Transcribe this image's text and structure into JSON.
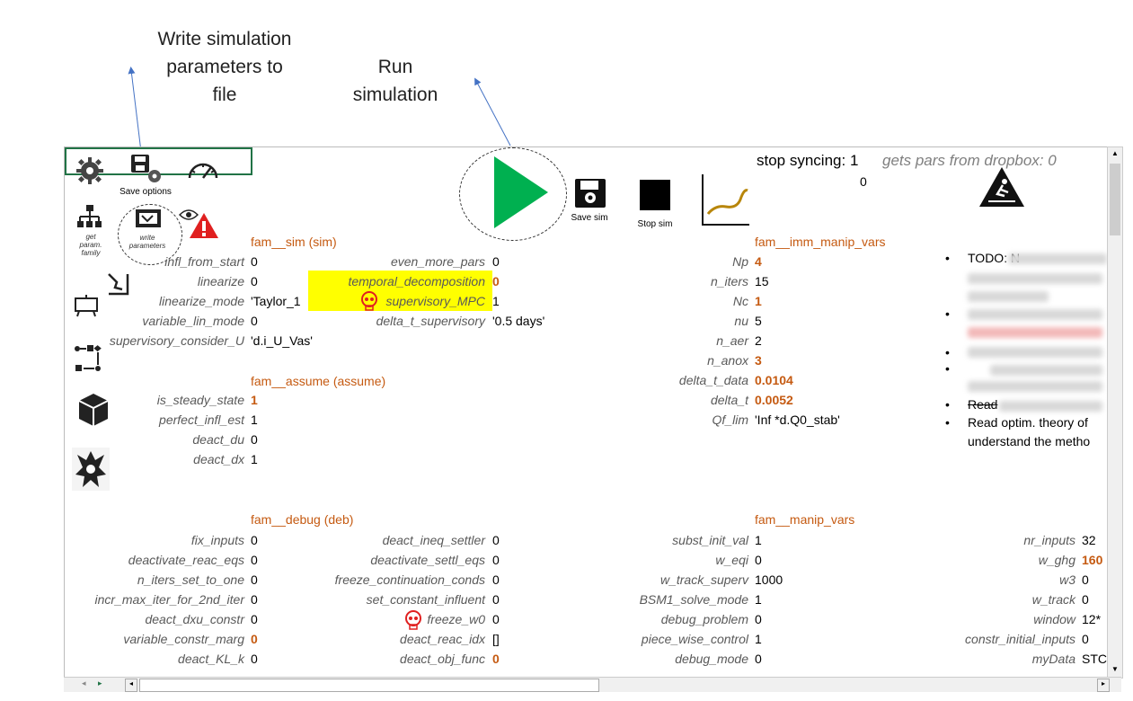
{
  "callouts": {
    "write_params": [
      "Write simulation",
      "parameters to",
      "file"
    ],
    "run_sim": [
      "Run",
      "simulation"
    ]
  },
  "toolbar": {
    "save_options": "Save options",
    "get_param_family": [
      "get",
      "param.",
      "family"
    ],
    "write_parameters": [
      "write",
      "parameters"
    ],
    "save_sim": "Save sim",
    "stop_sim": "Stop sim"
  },
  "header": {
    "stop_syncing_label": "stop syncing: 1",
    "stop_syncing_value": "0",
    "gets_pars": "gets pars from dropbox: 0"
  },
  "colors": {
    "accent_orange": "#c55a11",
    "play_green": "#00b050",
    "highlight_yellow": "#ffff00",
    "warning_red": "#e02020"
  },
  "sim": {
    "title": "fam__sim (sim)",
    "rows": [
      {
        "label": "infl_from_start",
        "value": "0"
      },
      {
        "label": "linearize",
        "value": "0"
      },
      {
        "label": "linearize_mode",
        "value": "'Taylor_1"
      },
      {
        "label": "variable_lin_mode",
        "value": "0"
      },
      {
        "label": "supervisory_consider_U",
        "value": "'d.i_U_Vas'"
      }
    ],
    "rows2": [
      {
        "label": "even_more_pars",
        "value": "0"
      },
      {
        "label": "temporal_decomposition",
        "value": "0"
      },
      {
        "label": "supervisory_MPC",
        "value": "1"
      },
      {
        "label": "delta_t_supervisory",
        "value": "'0.5 days'"
      }
    ]
  },
  "assume": {
    "title": "fam__assume (assume)",
    "rows": [
      {
        "label": "is_steady_state",
        "value": "1"
      },
      {
        "label": "perfect_infl_est",
        "value": "1"
      },
      {
        "label": "deact_du",
        "value": "0"
      },
      {
        "label": "deact_dx",
        "value": "1"
      }
    ]
  },
  "imm": {
    "title": "fam__imm_manip_vars",
    "rows": [
      {
        "label": "Np",
        "value": "4"
      },
      {
        "label": "n_iters",
        "value": "15"
      },
      {
        "label": "Nc",
        "value": "1"
      },
      {
        "label": "nu",
        "value": "5"
      },
      {
        "label": "n_aer",
        "value": "2"
      },
      {
        "label": "n_anox",
        "value": "3"
      },
      {
        "label": "delta_t_data",
        "value": "0.0104"
      },
      {
        "label": "delta_t",
        "value": "0.0052"
      },
      {
        "label": "Qf_lim",
        "value": "'Inf *d.Q0_stab'"
      }
    ]
  },
  "todo": {
    "items": [
      "TODO: N",
      "Read",
      "Read optim. theory of",
      "understand the metho"
    ]
  },
  "debug": {
    "title": "fam__debug (deb)",
    "col1": [
      {
        "label": "fix_inputs",
        "value": "0"
      },
      {
        "label": "deactivate_reac_eqs",
        "value": "0"
      },
      {
        "label": "n_iters_set_to_one",
        "value": "0"
      },
      {
        "label": "incr_max_iter_for_2nd_iter",
        "value": "0"
      },
      {
        "label": "deact_dxu_constr",
        "value": "0"
      },
      {
        "label": "variable_constr_marg",
        "value": "0"
      },
      {
        "label": "deact_KL_k",
        "value": "0"
      }
    ],
    "col2": [
      {
        "label": "deact_ineq_settler",
        "value": "0"
      },
      {
        "label": "deactivate_settl_eqs",
        "value": "0"
      },
      {
        "label": "freeze_continuation_conds",
        "value": "0"
      },
      {
        "label": "set_constant_influent",
        "value": "0"
      },
      {
        "label": "freeze_w0",
        "value": "0"
      },
      {
        "label": "deact_reac_idx",
        "value": "[]"
      },
      {
        "label": "deact_obj_func",
        "value": "0"
      }
    ]
  },
  "manip": {
    "title": "fam__manip_vars",
    "col1": [
      {
        "label": "subst_init_val",
        "value": "1"
      },
      {
        "label": "w_eqi",
        "value": "0"
      },
      {
        "label": "w_track_superv",
        "value": "1000"
      },
      {
        "label": "BSM1_solve_mode",
        "value": "1"
      },
      {
        "label": "debug_problem",
        "value": "0"
      },
      {
        "label": "piece_wise_control",
        "value": "1"
      },
      {
        "label": "debug_mode",
        "value": "0"
      }
    ],
    "col2": [
      {
        "label": "nr_inputs",
        "value": "32"
      },
      {
        "label": "w_ghg",
        "value": "160"
      },
      {
        "label": "w3",
        "value": "0"
      },
      {
        "label": "w_track",
        "value": "0"
      },
      {
        "label": "window",
        "value": "12*"
      },
      {
        "label": "constr_initial_inputs",
        "value": "0"
      },
      {
        "label": "myData",
        "value": "STC"
      }
    ]
  }
}
